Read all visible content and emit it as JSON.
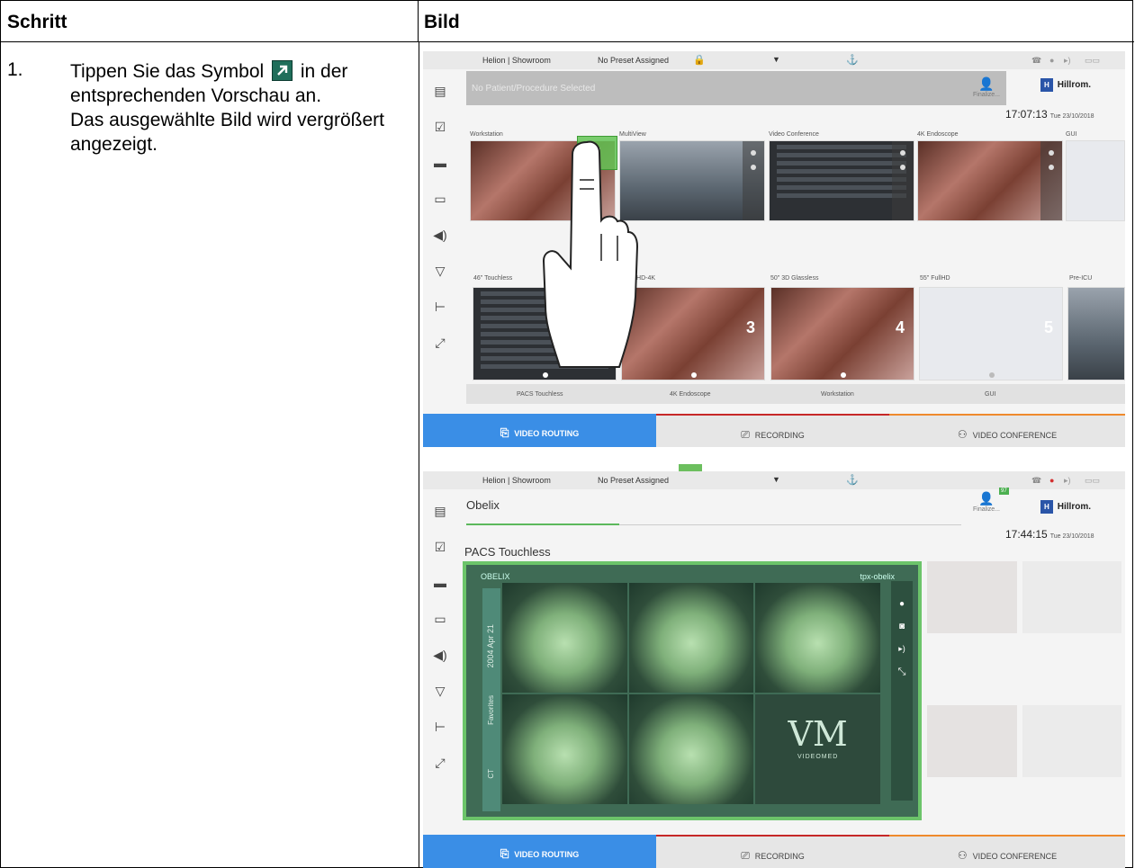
{
  "table": {
    "col_step": "Schritt",
    "col_image": "Bild"
  },
  "step": {
    "number": "1.",
    "text_before_icon": "Tippen Sie das Symbol",
    "text_after_icon": "in der entsprechenden Vorschau an.",
    "text_result": "Das ausgewählte Bild wird vergrößert angezeigt."
  },
  "screen1": {
    "topbar": {
      "site": "Helion | Showroom",
      "preset": "No Preset Assigned"
    },
    "patient_placeholder": "No Patient/Procedure Selected",
    "finalize": "Finalize...",
    "logo": "Hillrom.",
    "logo_mark": "H",
    "clock": "17:07:13",
    "date": "Tue 23/10/2018",
    "sources": [
      "Workstation",
      "MultiView",
      "Video Conference",
      "4K Endoscope",
      "GUI"
    ],
    "displays": [
      "46\" Touchless",
      "UHD-4K",
      "50\" 3D Glassless",
      "55\" FullHD",
      "Pre-ICU"
    ],
    "display_numbers": [
      "3",
      "4",
      "5"
    ],
    "assigned": [
      "PACS Touchless",
      "4K Endoscope",
      "Workstation",
      "GUI"
    ]
  },
  "screen2": {
    "topbar": {
      "site": "Helion | Showroom",
      "preset": "No Preset Assigned"
    },
    "patient": "Obelix",
    "badge": "97",
    "finalize": "Finalize...",
    "logo": "Hillrom.",
    "logo_mark": "H",
    "clock": "17:44:15",
    "date": "Tue 23/10/2018",
    "preview_title": "PACS Touchless",
    "preview_head_left": "OBELIX",
    "preview_head_right": "tpx-obelix",
    "preview_side_date": "2004 Apr 21",
    "preview_side_fav": "Favorites",
    "preview_side_ct": "CT",
    "vm_logo": "VM",
    "vm_brand": "VIDEOMED"
  },
  "tabs": [
    "VIDEO ROUTING",
    "RECORDING",
    "VIDEO CONFERENCE"
  ],
  "colors": {
    "active_tab": "#3a8ee6",
    "recording": "#c62828",
    "conference": "#ef8a2c",
    "highlight": "#6cc46a",
    "arrow": "#6cbf5e"
  }
}
